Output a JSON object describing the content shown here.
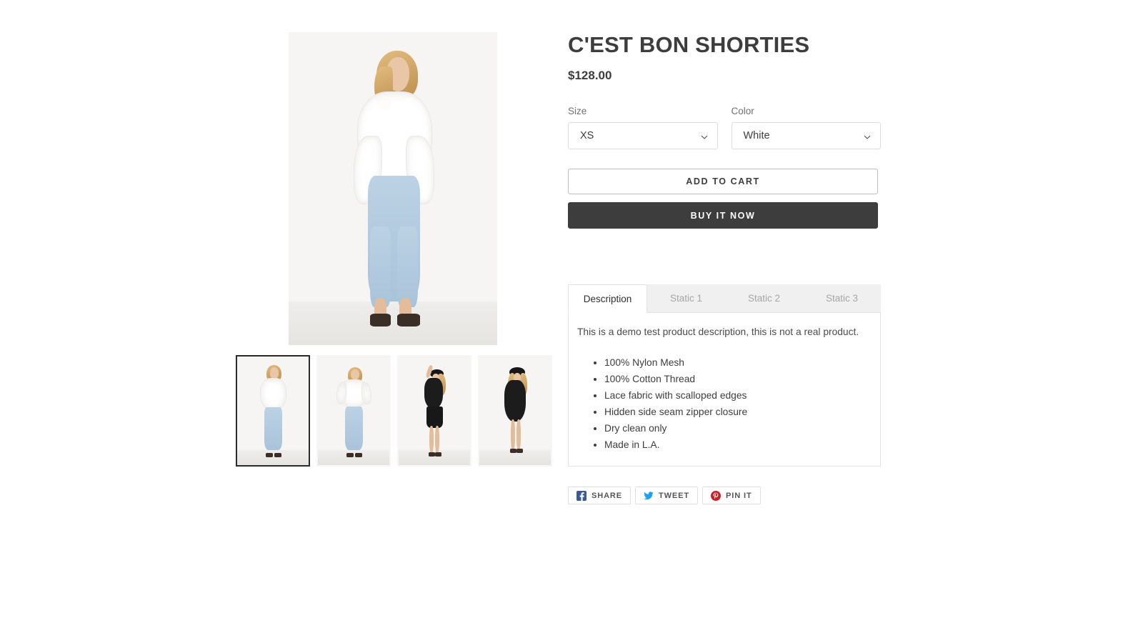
{
  "product": {
    "title": "C'EST BON SHORTIES",
    "price": "$128.00"
  },
  "options": [
    {
      "label": "Size",
      "value": "XS",
      "icon": "chevron-down-icon"
    },
    {
      "label": "Color",
      "value": "White",
      "icon": "chevron-down-icon"
    }
  ],
  "actions": {
    "add_to_cart": "ADD TO CART",
    "buy_it_now": "BUY IT NOW"
  },
  "tabs": [
    {
      "label": "Description",
      "active": true
    },
    {
      "label": "Static 1",
      "active": false
    },
    {
      "label": "Static 2",
      "active": false
    },
    {
      "label": "Static 3",
      "active": false
    }
  ],
  "description": {
    "intro": "This is a demo test product description, this is not a real product.",
    "bullets": [
      "100% Nylon Mesh",
      "100% Cotton Thread",
      "Lace fabric with scalloped edges",
      "Hidden side seam zipper closure",
      "Dry clean only",
      "Made in L.A."
    ]
  },
  "share": [
    {
      "label": "SHARE",
      "icon": "facebook-icon",
      "color": "#3b5998"
    },
    {
      "label": "TWEET",
      "icon": "twitter-icon",
      "color": "#1da1f2"
    },
    {
      "label": "PIN IT",
      "icon": "pinterest-icon",
      "color": "#cb2027"
    }
  ],
  "gallery": {
    "main_alt": "Model wearing white lace top with light blue jeans",
    "thumbs": [
      {
        "alt": "White lace top side view",
        "selected": true
      },
      {
        "alt": "White lace top arms raised",
        "selected": false
      },
      {
        "alt": "Black lace top with black skirt",
        "selected": false
      },
      {
        "alt": "Black lace dress with hat",
        "selected": false
      }
    ]
  },
  "colors": {
    "text": "#3d3d3d",
    "muted": "#a6a6a6",
    "border": "#e3e3e3",
    "dark_button": "#3d3d3d"
  }
}
